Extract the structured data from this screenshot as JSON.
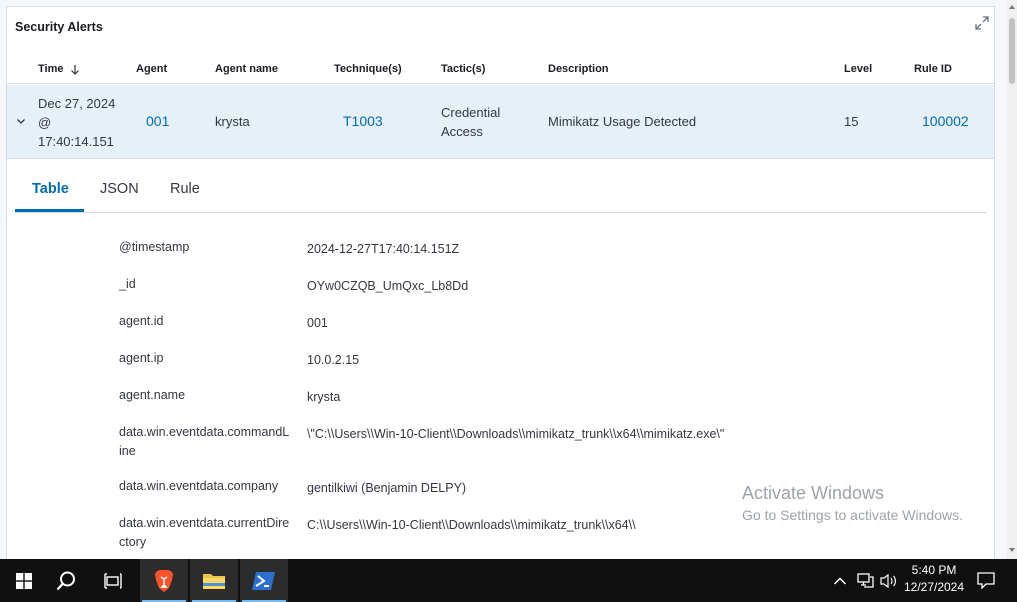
{
  "panel": {
    "title": "Security Alerts",
    "columns": {
      "time": "Time",
      "agent": "Agent",
      "agent_name": "Agent name",
      "techniques": "Technique(s)",
      "tactics": "Tactic(s)",
      "description": "Description",
      "level": "Level",
      "rule_id": "Rule ID"
    },
    "row": {
      "time_line1": "Dec 27, 2024",
      "time_line2": "@",
      "time_line3": "17:40:14.151",
      "agent": "001",
      "agent_name": "krysta",
      "technique": "T1003",
      "tactic_line1": "Credential",
      "tactic_line2": "Access",
      "description": "Mimikatz Usage Detected",
      "level": "15",
      "rule_id": "100002"
    },
    "tabs": [
      "Table",
      "JSON",
      "Rule"
    ],
    "active_tab": "Table",
    "fields": [
      {
        "name": "@timestamp",
        "value": "2024-12-27T17:40:14.151Z"
      },
      {
        "name": "_id",
        "value": "OYw0CZQB_UmQxc_Lb8Dd"
      },
      {
        "name": "agent.id",
        "value": "001"
      },
      {
        "name": "agent.ip",
        "value": "10.0.2.15"
      },
      {
        "name": "agent.name",
        "value": "krysta"
      },
      {
        "name": "data.win.eventdata.commandLine",
        "value": "\\\"C:\\\\Users\\\\Win-10-Client\\\\Downloads\\\\mimikatz_trunk\\\\x64\\\\mimikatz.exe\\\""
      },
      {
        "name": "data.win.eventdata.company",
        "value": "gentilkiwi (Benjamin DELPY)"
      },
      {
        "name": "data.win.eventdata.currentDirectory",
        "value": "C:\\\\Users\\\\Win-10-Client\\\\Downloads\\\\mimikatz_trunk\\\\x64\\\\"
      }
    ]
  },
  "watermark": {
    "line1": "Activate Windows",
    "line2": "Go to Settings to activate Windows."
  },
  "taskbar": {
    "time": "5:40 PM",
    "date": "12/27/2024",
    "apps": [
      "start-icon",
      "search-icon",
      "task-view-icon",
      "brave-browser-icon",
      "file-explorer-icon",
      "powershell-icon"
    ]
  },
  "colors": {
    "accent": "#006bb4",
    "selected_row": "#e6f0f8",
    "taskbar": "#101010"
  }
}
